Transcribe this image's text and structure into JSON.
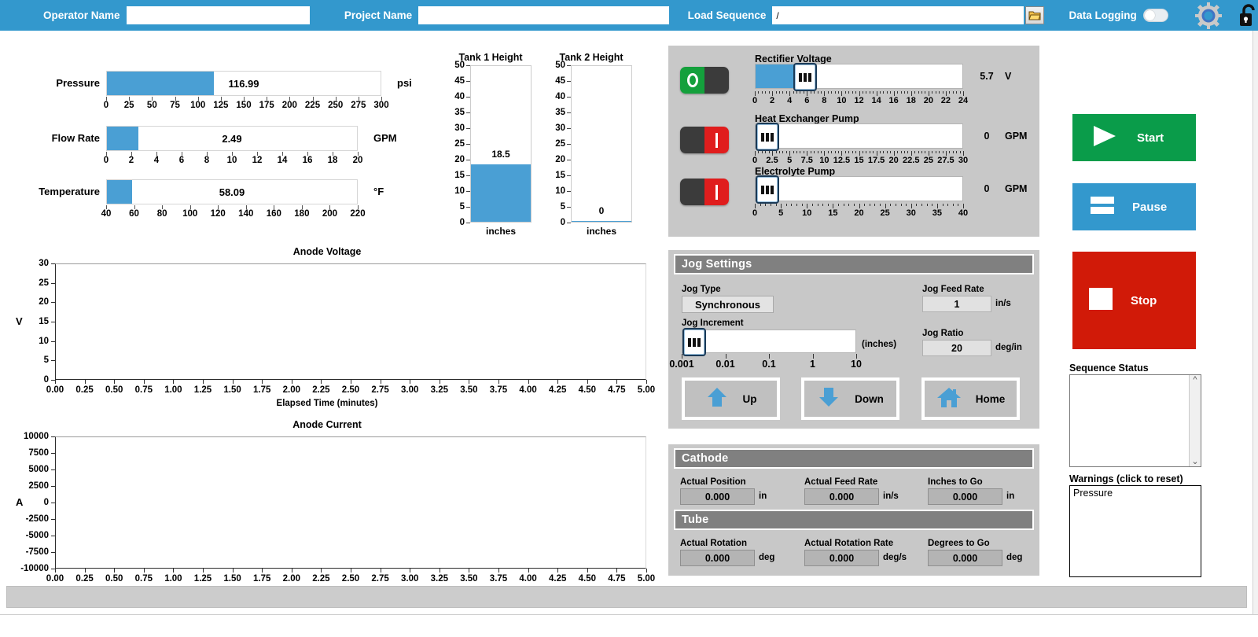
{
  "topbar": {
    "operator_label": "Operator Name",
    "operator_value": "",
    "operator_placeholder": "",
    "project_label": "Project Name",
    "project_value": "",
    "project_placeholder": "",
    "load_sequence_label": "Load Sequence",
    "load_sequence_value": "/",
    "folder_icon": "folder-open-icon",
    "data_logging_label": "Data Logging",
    "data_logging_state": "off",
    "gear_icon": "gear-icon",
    "lock_icon": "lock-icon",
    "bg_color": "#3398cd"
  },
  "gauges": [
    {
      "label": "Pressure",
      "value": "116.99",
      "unit": "psi",
      "min": 0,
      "max": 300,
      "fill_value": 116.99,
      "ticks": [
        "0",
        "25",
        "50",
        "75",
        "100",
        "125",
        "150",
        "175",
        "200",
        "225",
        "250",
        "275",
        "300"
      ]
    },
    {
      "label": "Flow Rate",
      "value": "2.49",
      "unit": "GPM",
      "min": 0,
      "max": 20,
      "fill_value": 2.49,
      "ticks": [
        "0",
        "2",
        "4",
        "6",
        "8",
        "10",
        "12",
        "14",
        "16",
        "18",
        "20"
      ]
    },
    {
      "label": "Temperature",
      "value": "58.09",
      "unit": "°F",
      "min": 40,
      "max": 220,
      "fill_value": 58.09,
      "ticks": [
        "40",
        "60",
        "80",
        "100",
        "120",
        "140",
        "160",
        "180",
        "200",
        "220"
      ]
    }
  ],
  "tanks": [
    {
      "title": "Tank 1 Height",
      "value": "18.5",
      "value_num": 18.5,
      "unit": "inches",
      "ymin": 0,
      "ymax": 50,
      "yticks": [
        "0",
        "5",
        "10",
        "15",
        "20",
        "25",
        "30",
        "35",
        "40",
        "45",
        "50"
      ]
    },
    {
      "title": "Tank 2 Height",
      "value": "0",
      "value_num": 0.25,
      "unit": "inches",
      "ymin": 0,
      "ymax": 50,
      "yticks": [
        "0",
        "5",
        "10",
        "15",
        "20",
        "25",
        "30",
        "35",
        "40",
        "45",
        "50"
      ]
    }
  ],
  "chart_data": [
    {
      "type": "line",
      "title": "Anode Voltage",
      "xlabel": "Elapsed Time (minutes)",
      "ylabel": "V",
      "ylim": [
        0,
        30
      ],
      "xlim": [
        0,
        5
      ],
      "yticks": [
        "0",
        "5",
        "10",
        "15",
        "20",
        "25",
        "30"
      ],
      "xticks": [
        "0.00",
        "0.25",
        "0.50",
        "0.75",
        "1.00",
        "1.25",
        "1.50",
        "1.75",
        "2.00",
        "2.25",
        "2.50",
        "2.75",
        "3.00",
        "3.25",
        "3.50",
        "3.75",
        "4.00",
        "4.25",
        "4.50",
        "4.75",
        "5.00"
      ],
      "grid": false,
      "legend": "none",
      "series": [
        {
          "name": "Anode Voltage",
          "x": [],
          "y": []
        }
      ]
    },
    {
      "type": "line",
      "title": "Anode Current",
      "xlabel": "Elapsed Time (minutes)",
      "ylabel": "A",
      "ylim": [
        -10000,
        10000
      ],
      "xlim": [
        0,
        5
      ],
      "yticks": [
        "-10000",
        "-7500",
        "-5000",
        "-2500",
        "0",
        "2500",
        "5000",
        "7500",
        "10000"
      ],
      "xticks": [
        "0.00",
        "0.25",
        "0.50",
        "0.75",
        "1.00",
        "1.25",
        "1.50",
        "1.75",
        "2.00",
        "2.25",
        "2.50",
        "2.75",
        "3.00",
        "3.25",
        "3.50",
        "3.75",
        "4.00",
        "4.25",
        "4.50",
        "4.75",
        "5.00"
      ],
      "grid": false,
      "legend": "none",
      "series": [
        {
          "name": "Anode Current",
          "x": [],
          "y": []
        }
      ]
    }
  ],
  "controls": [
    {
      "name": "rectifier-voltage",
      "label": "Rectifier Voltage",
      "switch_state": "on",
      "value": "5.7",
      "unit": "V",
      "slider_value": 5.7,
      "min": 0,
      "max": 24,
      "ticks": [
        "0",
        "2",
        "4",
        "6",
        "8",
        "10",
        "12",
        "14",
        "16",
        "18",
        "20",
        "22",
        "24"
      ]
    },
    {
      "name": "heat-exchanger-pump",
      "label": "Heat Exchanger Pump",
      "switch_state": "off",
      "value": "0",
      "unit": "GPM",
      "slider_value": 0,
      "min": 0,
      "max": 30,
      "ticks": [
        "0",
        "2.5",
        "5",
        "7.5",
        "10",
        "12.5",
        "15",
        "17.5",
        "20",
        "22.5",
        "25",
        "27.5",
        "30"
      ]
    },
    {
      "name": "electrolyte-pump",
      "label": "Electrolyte Pump",
      "switch_state": "off",
      "value": "0",
      "unit": "GPM",
      "slider_value": 0,
      "min": 0,
      "max": 40,
      "ticks": [
        "0",
        "5",
        "10",
        "15",
        "20",
        "25",
        "30",
        "35",
        "40"
      ]
    }
  ],
  "jog": {
    "header": "Jog Settings",
    "jog_type_label": "Jog Type",
    "jog_type_value": "Synchronous",
    "jog_feed_rate_label": "Jog Feed Rate",
    "jog_feed_rate_value": "1",
    "jog_feed_rate_unit": "in/s",
    "jog_increment_label": "Jog Increment",
    "jog_increment_unit": "(inches)",
    "jog_increment_ticks": [
      "0.001",
      "0.01",
      "0.1",
      "1",
      "10"
    ],
    "jog_ratio_label": "Jog Ratio",
    "jog_ratio_value": "20",
    "jog_ratio_unit": "deg/in",
    "buttons": [
      {
        "label": "Up",
        "icon": "arrow-up-icon"
      },
      {
        "label": "Down",
        "icon": "arrow-down-icon"
      },
      {
        "label": "Home",
        "icon": "home-icon"
      }
    ]
  },
  "cathode": {
    "header": "Cathode",
    "fields": [
      {
        "label": "Actual Position",
        "value": "0.000",
        "unit": "in"
      },
      {
        "label": "Actual Feed Rate",
        "value": "0.000",
        "unit": "in/s"
      },
      {
        "label": "Inches to Go",
        "value": "0.000",
        "unit": "in"
      }
    ]
  },
  "tube": {
    "header": "Tube",
    "fields": [
      {
        "label": "Actual Rotation",
        "value": "0.000",
        "unit": "deg"
      },
      {
        "label": "Actual Rotation Rate",
        "value": "0.000",
        "unit": "deg/s"
      },
      {
        "label": "Degrees to Go",
        "value": "0.000",
        "unit": "deg"
      }
    ]
  },
  "actions": [
    {
      "name": "start",
      "label": "Start",
      "icon": "play-icon",
      "color": "#0a9c4a"
    },
    {
      "name": "pause",
      "label": "Pause",
      "icon": "pause-icon",
      "color": "#3398cd"
    },
    {
      "name": "stop",
      "label": "Stop",
      "icon": "stop-icon",
      "color": "#d11a08"
    }
  ],
  "status": {
    "sequence_status_label": "Sequence Status",
    "sequence_status_items": [],
    "warnings_label": "Warnings (click to reset)",
    "warnings_items": [
      "Pressure"
    ]
  }
}
